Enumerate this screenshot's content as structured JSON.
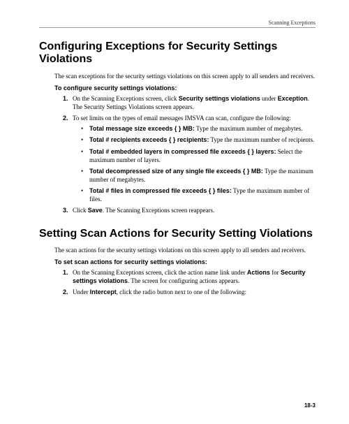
{
  "header": "Scanning Exceptions",
  "page_number": "18-3",
  "section1": {
    "title": "Configuring Exceptions for Security Settings Violations",
    "intro": "The scan exceptions for the security settings violations on this screen apply to all senders and receivers.",
    "subhead": "To configure security settings violations:",
    "step1_a": "On the Scanning Exceptions screen, click ",
    "step1_b": "Security settings violations",
    "step1_c": " under ",
    "step1_d": "Exception",
    "step1_e": ". The Security Settings Violations screen appears.",
    "step2": "To set limits on the types of email messages IMSVA can scan, configure the following:",
    "b1_a": "Total message size exceeds { } MB:",
    "b1_b": " Type the maximum number of megabytes.",
    "b2_a": "Total # recipients exceeds { } recipients:",
    "b2_b": " Type the maximum number of recipients.",
    "b3_a": "Total # embedded layers in compressed file exceeds { } layers:",
    "b3_b": " Select the maximum number of layers.",
    "b4_a": "Total decompressed size of any single file exceeds { } MB:",
    "b4_b": " Type the maximum number of megabytes.",
    "b5_a": "Total # files in compressed file exceeds { } files:",
    "b5_b": " Type the maximum number of files.",
    "step3_a": "Click ",
    "step3_b": "Save",
    "step3_c": ". The Scanning Exceptions screen reappears."
  },
  "section2": {
    "title": "Setting Scan Actions for Security Setting Violations",
    "intro": "The scan actions for the security settings violations on this screen apply to all senders and receivers.",
    "subhead": "To set scan actions for security settings violations:",
    "step1_a": "On the Scanning Exceptions screen, click the action name link under ",
    "step1_b": "Actions",
    "step1_c": " for ",
    "step1_d": "Security settings violations",
    "step1_e": ". The screen for configuring actions appears.",
    "step2_a": "Under ",
    "step2_b": "Intercept",
    "step2_c": ", click the radio button next to one of the following:"
  }
}
